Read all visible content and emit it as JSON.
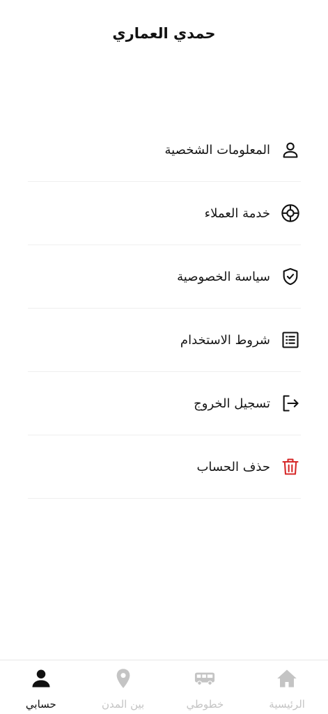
{
  "header": {
    "user_name": "حمدي العماري"
  },
  "menu": {
    "items": [
      {
        "label": "المعلومات الشخصية",
        "icon": "user-outline-icon"
      },
      {
        "label": "خدمة العملاء",
        "icon": "lifebuoy-icon"
      },
      {
        "label": "سياسة الخصوصية",
        "icon": "shield-check-icon"
      },
      {
        "label": "شروط الاستخدام",
        "icon": "list-document-icon"
      },
      {
        "label": "تسجيل الخروج",
        "icon": "logout-icon"
      },
      {
        "label": "حذف الحساب",
        "icon": "trash-icon"
      }
    ]
  },
  "bottom_nav": {
    "items": [
      {
        "label": "حسابي",
        "icon": "person-icon",
        "active": true
      },
      {
        "label": "بين المدن",
        "icon": "map-pin-icon",
        "active": false
      },
      {
        "label": "خطوطي",
        "icon": "bus-icon",
        "active": false
      },
      {
        "label": "الرئيسية",
        "icon": "home-icon",
        "active": false
      }
    ]
  },
  "colors": {
    "text_primary": "#111111",
    "nav_inactive": "#c4c4c4",
    "danger": "#d62828",
    "divider": "#efefef"
  }
}
